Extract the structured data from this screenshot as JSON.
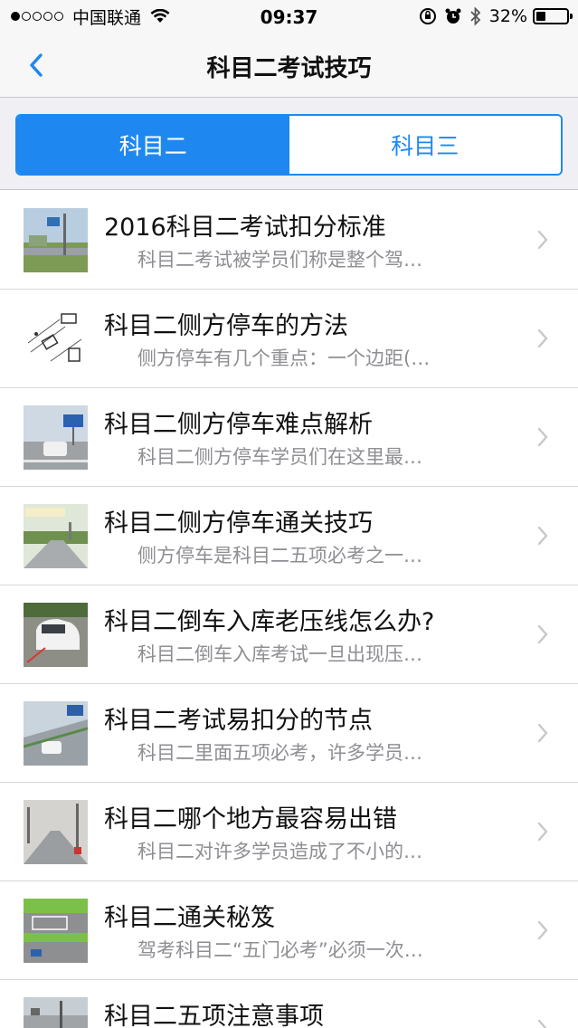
{
  "status_bar": {
    "carrier": "中国联通",
    "time": "09:37",
    "battery": "32%",
    "battery_level": 0.32,
    "signal_bars_filled": 1,
    "signal_bars_total": 5
  },
  "nav": {
    "title": "科目二考试技巧",
    "back_icon": "chevron-left-icon"
  },
  "tabs": [
    {
      "label": "科目二",
      "active": true
    },
    {
      "label": "科目三",
      "active": false
    }
  ],
  "colors": {
    "accent": "#1e88f0",
    "subtitle": "#8e8e93",
    "separator": "#d6d6da"
  },
  "articles": [
    {
      "title": "2016科目二考试扣分标准",
      "subtitle": "科目二考试被学员们称是整个驾…",
      "thumb": "road-sign-photo"
    },
    {
      "title": "科目二侧方停车的方法",
      "subtitle": "侧方停车有几个重点：一个边距(…",
      "thumb": "parking-diagram"
    },
    {
      "title": "科目二侧方停车难点解析",
      "subtitle": "科目二侧方停车学员们在这里最…",
      "thumb": "car-on-course-photo"
    },
    {
      "title": "科目二侧方停车通关技巧",
      "subtitle": "侧方停车是科目二五项必考之一…",
      "thumb": "parking-course-photo"
    },
    {
      "title": "科目二倒车入库老压线怎么办?",
      "subtitle": "科目二倒车入库考试一旦出现压…",
      "thumb": "white-car-photo"
    },
    {
      "title": "科目二考试易扣分的节点",
      "subtitle": "科目二里面五项必考，许多学员…",
      "thumb": "ramp-course-photo"
    },
    {
      "title": "科目二哪个地方最容易出错",
      "subtitle": "科目二对许多学员造成了不小的…",
      "thumb": "road-photo"
    },
    {
      "title": "科目二通关秘笈",
      "subtitle": "驾考科目二“五门必考”必须一次…",
      "thumb": "course-map-illustration"
    },
    {
      "title": "科目二五项注意事项",
      "subtitle": "",
      "thumb": "test-track-photo"
    }
  ]
}
